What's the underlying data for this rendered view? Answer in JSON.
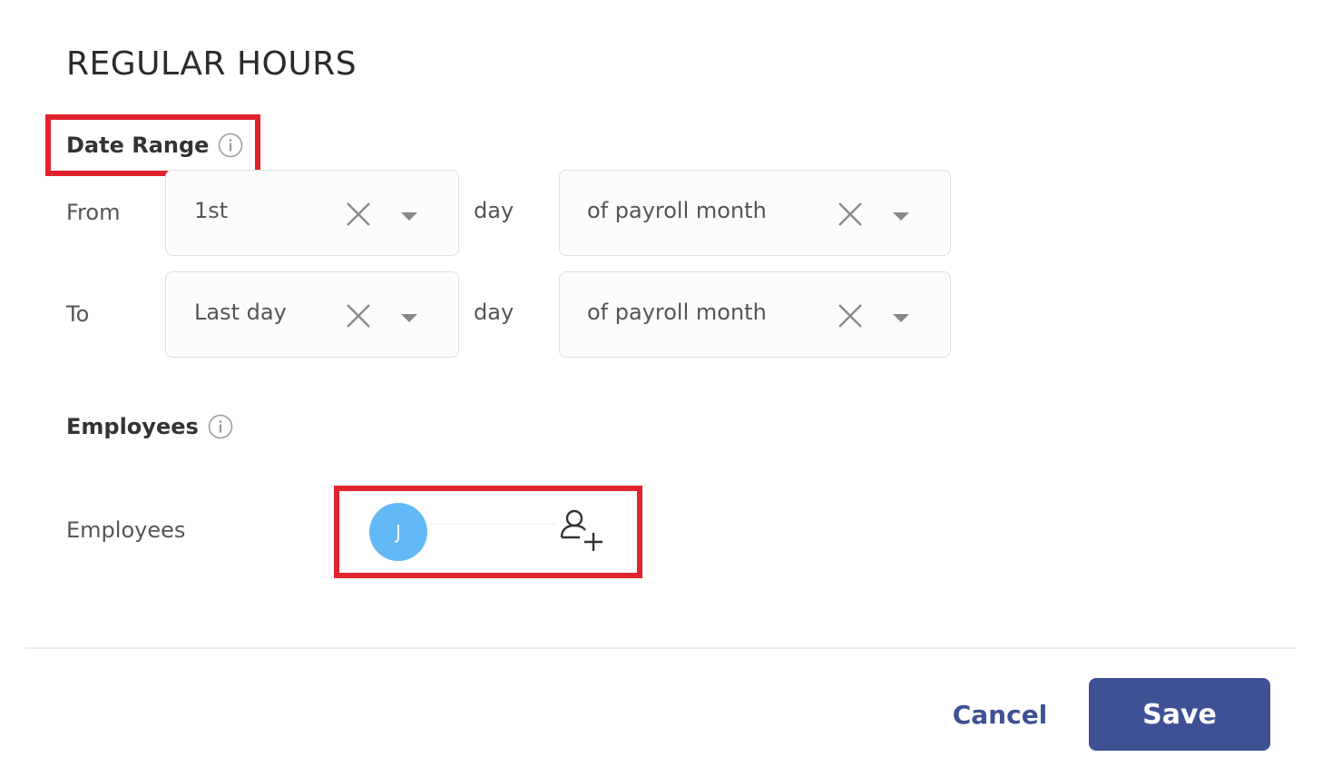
{
  "dialog": {
    "title": "REGULAR HOURS"
  },
  "date_range": {
    "section_label": "Date Range",
    "rows": [
      {
        "label": "From",
        "day_value": "1st",
        "day_word": "day",
        "period_value": "of payroll month"
      },
      {
        "label": "To",
        "day_value": "Last day",
        "day_word": "day",
        "period_value": "of payroll month"
      }
    ]
  },
  "employees": {
    "section_label": "Employees",
    "field_label": "Employees",
    "avatar_initial": "J"
  },
  "footer": {
    "cancel_label": "Cancel",
    "save_label": "Save"
  },
  "colors": {
    "primary": "#3e5194",
    "highlight": "#e1232e",
    "avatar": "#63b9f5"
  }
}
